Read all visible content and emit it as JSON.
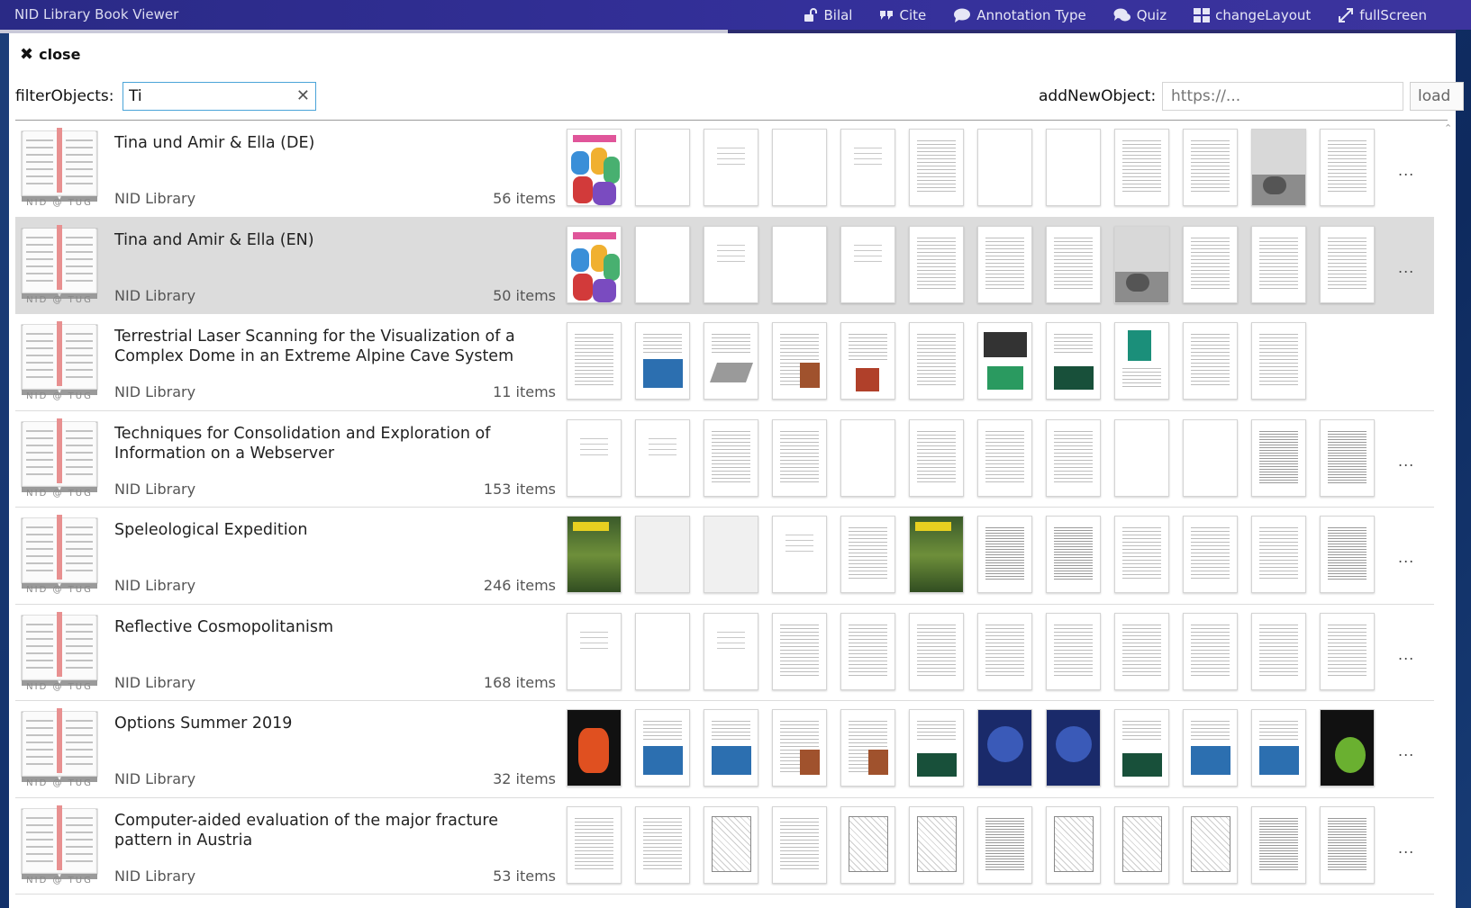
{
  "app": {
    "title": "NID Library Book Viewer"
  },
  "menu": [
    {
      "label": "Bilal",
      "icon": "unlock-icon"
    },
    {
      "label": "Cite",
      "icon": "quote-icon"
    },
    {
      "label": "Annotation Type",
      "icon": "comment-icon"
    },
    {
      "label": "Quiz",
      "icon": "comments-icon"
    },
    {
      "label": "changeLayout",
      "icon": "grid-layout-icon"
    },
    {
      "label": "fullScreen",
      "icon": "expand-icon"
    }
  ],
  "dialog": {
    "close_label": "close",
    "filter_label": "filterObjects:",
    "filter_value": "Ti",
    "add_label": "addNewObject:",
    "add_placeholder": "https://...",
    "load_label": "load"
  },
  "icon_caption": "NID @ TUG",
  "more_label": "...",
  "rows": [
    {
      "title": "Tina und Amir & Ella (DE)",
      "source": "NID Library",
      "count": "56 items",
      "selected": false,
      "thumbs": [
        "color",
        "blank",
        "text-sparse",
        "blank",
        "text-sparse",
        "text",
        "blank",
        "blank",
        "text",
        "text",
        "photo",
        "text"
      ],
      "more": true
    },
    {
      "title": "Tina and Amir & Ella (EN)",
      "source": "NID Library",
      "count": "50 items",
      "selected": true,
      "thumbs": [
        "color",
        "blank",
        "text-sparse",
        "blank",
        "text-sparse",
        "text",
        "text",
        "text",
        "photo",
        "text",
        "text",
        "text"
      ],
      "more": true
    },
    {
      "title": "Terrestrial Laser Scanning for the Visualization of a Complex Dome in an Extreme Alpine Cave System",
      "source": "NID Library",
      "count": "11 items",
      "selected": false,
      "thumbs": [
        "text",
        "figure-blue",
        "figure-gray",
        "figure-brown",
        "figure-red",
        "text",
        "figure-dark",
        "figure-green",
        "figure-map",
        "text",
        "text"
      ],
      "more": false
    },
    {
      "title": "Techniques for Consolidation and Exploration of Information on a Webserver",
      "source": "NID Library",
      "count": "153 items",
      "selected": false,
      "thumbs": [
        "text-sparse",
        "text-sparse",
        "text",
        "text",
        "blank",
        "text",
        "text",
        "text",
        "blank",
        "blank",
        "dense",
        "dense"
      ],
      "more": true
    },
    {
      "title": "Speleological Expedition",
      "source": "NID Library",
      "count": "246 items",
      "selected": false,
      "thumbs": [
        "cover-jungle",
        "gray",
        "gray",
        "text-sparse",
        "text",
        "cover-jungle",
        "dense",
        "dense",
        "text",
        "text",
        "text",
        "dense"
      ],
      "more": true
    },
    {
      "title": "Reflective Cosmopolitanism",
      "source": "NID Library",
      "count": "168 items",
      "selected": false,
      "thumbs": [
        "text-sparse",
        "blank",
        "text-sparse",
        "text",
        "text",
        "text",
        "text",
        "text",
        "text",
        "text",
        "text",
        "text"
      ],
      "more": true
    },
    {
      "title": "Options Summer 2019",
      "source": "NID Library",
      "count": "32 items",
      "selected": false,
      "thumbs": [
        "cover-orange",
        "figure-blue",
        "figure-blue",
        "figure-brown",
        "figure-brown",
        "figure-green",
        "cover-navy",
        "cover-navy",
        "figure-green",
        "figure-blue",
        "figure-blue",
        "cover-green"
      ],
      "more": true
    },
    {
      "title": "Computer-aided evaluation of the major fracture pattern in Austria",
      "source": "NID Library",
      "count": "53 items",
      "selected": false,
      "thumbs": [
        "text",
        "text",
        "figure-lines",
        "text",
        "figure-lines",
        "figure-lines",
        "dense",
        "figure-lines",
        "figure-lines",
        "figure-lines",
        "dense",
        "dense"
      ],
      "more": true
    }
  ]
}
